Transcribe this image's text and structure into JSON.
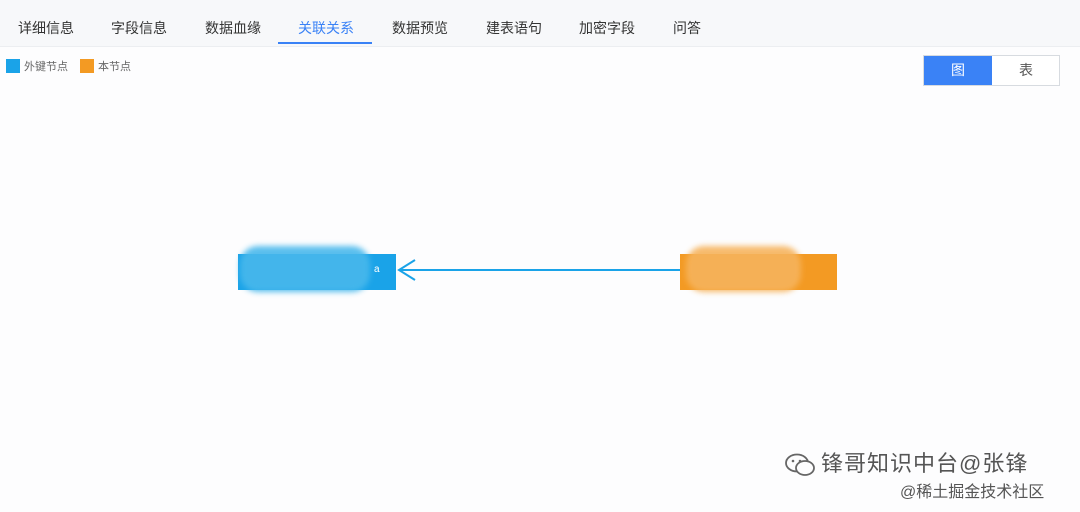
{
  "tabs": [
    {
      "label": "详细信息"
    },
    {
      "label": "字段信息"
    },
    {
      "label": "数据血缘"
    },
    {
      "label": "关联关系"
    },
    {
      "label": "数据预览"
    },
    {
      "label": "建表语句"
    },
    {
      "label": "加密字段"
    },
    {
      "label": "问答"
    }
  ],
  "active_tab": "关联关系",
  "legend": [
    {
      "label": "外键节点",
      "color": "#1aa3e8"
    },
    {
      "label": "本节点",
      "color": "#f39a23"
    }
  ],
  "view_toggle": {
    "graph_label": "图",
    "table_label": "表",
    "selected": "图"
  },
  "graph": {
    "edge_color": "#1aa3e8",
    "fk_node": {
      "visible_text": "a",
      "color": "#1aa3e8"
    },
    "self_node": {
      "color": "#f39a23"
    }
  },
  "watermark": {
    "line1": "锋哥知识中台@张锋",
    "line2": "@稀土掘金技术社区"
  }
}
